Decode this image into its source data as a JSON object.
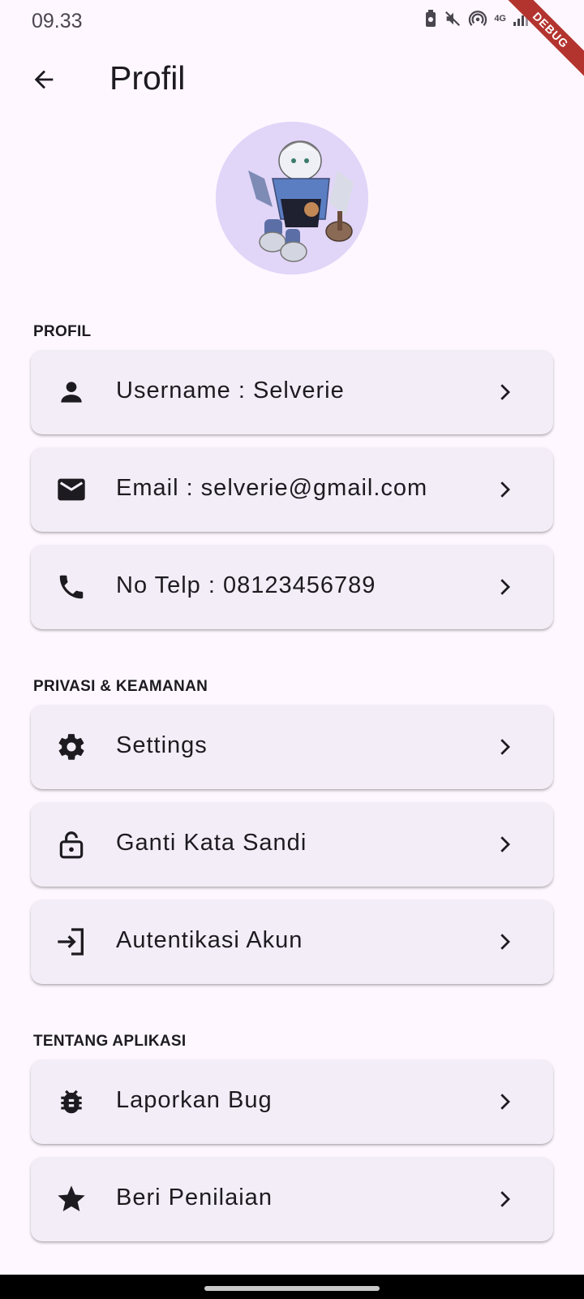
{
  "status_bar": {
    "time": "09.33",
    "network": "4G",
    "debug_banner": "DEBUG"
  },
  "app_bar": {
    "title": "Profil"
  },
  "sections": {
    "profil": {
      "label": "PROFIL",
      "items": [
        {
          "label": "Username : Selverie",
          "icon": "person-icon"
        },
        {
          "label": "Email : selverie@gmail.com",
          "icon": "mail-icon"
        },
        {
          "label": "No Telp : 08123456789",
          "icon": "phone-icon"
        }
      ]
    },
    "privacy": {
      "label": "PRIVASI & KEAMANAN",
      "items": [
        {
          "label": "Settings",
          "icon": "gear-icon"
        },
        {
          "label": "Ganti Kata Sandi",
          "icon": "lock-icon"
        },
        {
          "label": "Autentikasi Akun",
          "icon": "login-icon"
        }
      ]
    },
    "about": {
      "label": "TENTANG APLIKASI",
      "items": [
        {
          "label": "Laporkan Bug",
          "icon": "bug-icon"
        },
        {
          "label": "Beri Penilaian",
          "icon": "star-icon"
        }
      ]
    }
  },
  "colors": {
    "background": "#fef7ff",
    "card": "#f3edf7",
    "avatar_bg": "#e1d5f8",
    "text": "#1d1b20",
    "debug_ribbon": "#b3342f"
  }
}
